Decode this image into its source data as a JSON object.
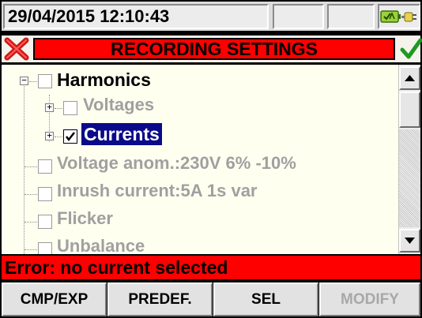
{
  "status_bar": {
    "datetime": "29/04/2015 12:10:43",
    "battery_icon": "battery-charging-icon",
    "plug_icon": "power-plug-icon"
  },
  "title_bar": {
    "title": "RECORDING SETTINGS",
    "cancel_icon": "red-x-icon",
    "confirm_icon": "green-check-icon"
  },
  "tree": {
    "items": [
      {
        "label": "Harmonics",
        "checked": false,
        "enabled": true
      },
      {
        "label": "Voltages",
        "checked": false,
        "enabled": false
      },
      {
        "label": "Currents",
        "checked": true,
        "enabled": true,
        "selected": true
      },
      {
        "label": "Voltage anom.:230V 6% -10%",
        "checked": false,
        "enabled": false
      },
      {
        "label": "Inrush current:5A 1s var",
        "checked": false,
        "enabled": false
      },
      {
        "label": "Flicker",
        "checked": false,
        "enabled": false
      },
      {
        "label": "Unbalance",
        "checked": false,
        "enabled": false
      }
    ]
  },
  "error": {
    "message": "Error: no current selected"
  },
  "softkeys": [
    {
      "label": "CMP/EXP",
      "enabled": true
    },
    {
      "label": "PREDEF.",
      "enabled": true
    },
    {
      "label": "SEL",
      "enabled": true
    },
    {
      "label": "MODIFY",
      "enabled": false
    }
  ],
  "colors": {
    "title_red": "#ff0000",
    "selection_blue": "#0a0a8a",
    "panel_bg": "#fffff0",
    "disabled_text": "#a0a0a0"
  }
}
